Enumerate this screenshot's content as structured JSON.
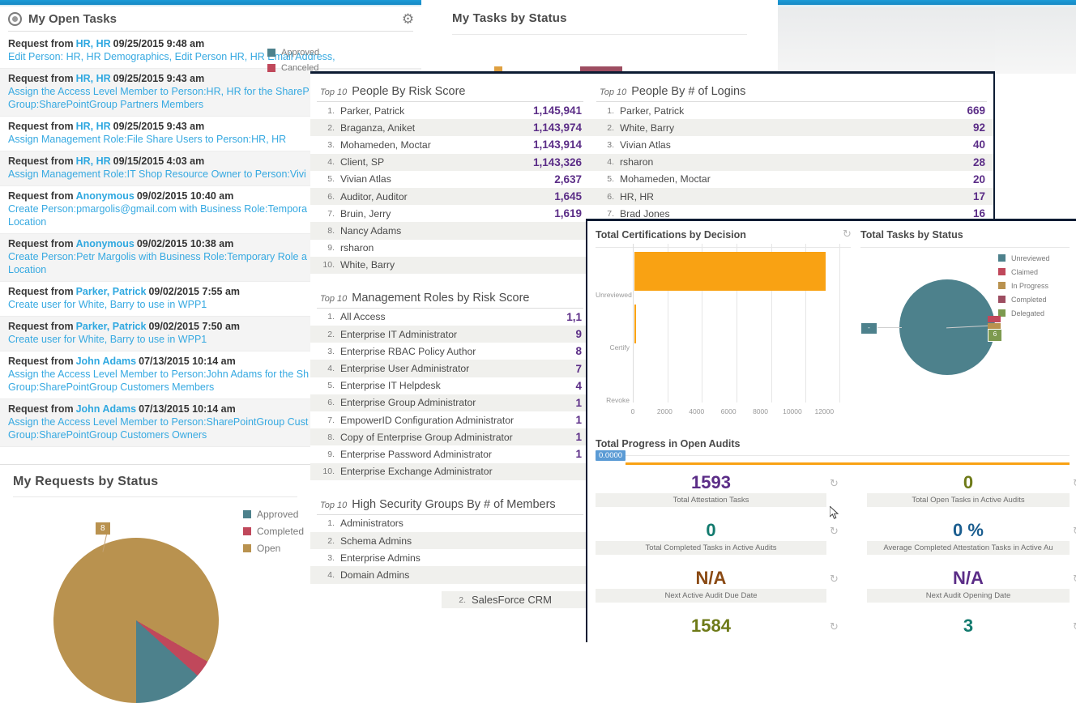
{
  "open_tasks": {
    "panel_title": "My Open Tasks",
    "radio_icon": "radio-button-icon",
    "gear_icon": "gear-icon",
    "items": [
      {
        "prefix": "Request from",
        "who": "HR, HR",
        "when": "09/25/2015 9:48 am",
        "desc": "Edit Person: HR, HR Demographics, Edit Person HR, HR Email Address,"
      },
      {
        "prefix": "Request from",
        "who": "HR, HR",
        "when": "09/25/2015 9:43 am",
        "desc": "Assign the Access Level Member to Person:HR, HR for the ShareP Group:SharePointGroup Partners Members"
      },
      {
        "prefix": "Request from",
        "who": "HR, HR",
        "when": "09/25/2015 9:43 am",
        "desc": "Assign Management Role:File Share Users to Person:HR, HR"
      },
      {
        "prefix": "Request from",
        "who": "HR, HR",
        "when": "09/15/2015 4:03 am",
        "desc": "Assign Management Role:IT Shop Resource Owner to Person:Vivi"
      },
      {
        "prefix": "Request from",
        "who": "Anonymous",
        "when": "09/02/2015 10:40 am",
        "desc": "Create Person:pmargolis@gmail.com with Business Role:Tempora Location:Temporary Location"
      },
      {
        "prefix": "Request from",
        "who": "Anonymous",
        "when": "09/02/2015 10:38 am",
        "desc": "Create Person:Petr Margolis with Business Role:Temporary Role a Location:Temporary Location"
      },
      {
        "prefix": "Request from",
        "who": "Parker, Patrick",
        "when": "09/02/2015 7:55 am",
        "desc": "Create user for White, Barry to use in WPP1"
      },
      {
        "prefix": "Request from",
        "who": "Parker, Patrick",
        "when": "09/02/2015 7:50 am",
        "desc": "Create user for White, Barry to use in WPP1"
      },
      {
        "prefix": "Request from",
        "who": "John Adams",
        "when": "07/13/2015 10:14 am",
        "desc": "Assign the Access Level Member to Person:John Adams for the Sh Group:SharePointGroup Customers Members"
      },
      {
        "prefix": "Request from",
        "who": "John Adams",
        "when": "07/13/2015 10:14 am",
        "desc": "Assign the Access Level Member to Person:SharePointGroup Cust SharePoint Group:SharePointGroup Customers Owners"
      }
    ]
  },
  "my_tasks_by_status": {
    "title": "My Tasks by Status",
    "refresh_icon": "refresh-icon",
    "legend": [
      {
        "label": "Approved",
        "color": "#4d818c"
      },
      {
        "label": "Canceled",
        "color": "#c0485b"
      }
    ]
  },
  "top_lists": [
    {
      "small": "Top 10",
      "title": "People By Risk Score",
      "rows": [
        {
          "idx": "1.",
          "name": "Parker, Patrick",
          "value": "1,145,941"
        },
        {
          "idx": "2.",
          "name": "Braganza, Aniket",
          "value": "1,143,974"
        },
        {
          "idx": "3.",
          "name": "Mohameden, Moctar",
          "value": "1,143,914"
        },
        {
          "idx": "4.",
          "name": "Client, SP",
          "value": "1,143,326"
        },
        {
          "idx": "5.",
          "name": "Vivian Atlas",
          "value": "2,637"
        },
        {
          "idx": "6.",
          "name": "Auditor, Auditor",
          "value": "1,645"
        },
        {
          "idx": "7.",
          "name": "Bruin, Jerry",
          "value": "1,619"
        },
        {
          "idx": "8.",
          "name": "Nancy Adams",
          "value": ""
        },
        {
          "idx": "9.",
          "name": "rsharon",
          "value": ""
        },
        {
          "idx": "10.",
          "name": "White, Barry",
          "value": ""
        }
      ]
    },
    {
      "small": "Top 10",
      "title": "Management Roles by Risk Score",
      "rows": [
        {
          "idx": "1.",
          "name": "All Access",
          "value": "1,1"
        },
        {
          "idx": "2.",
          "name": "Enterprise IT Administrator",
          "value": "9"
        },
        {
          "idx": "3.",
          "name": "Enterprise RBAC Policy Author",
          "value": "8"
        },
        {
          "idx": "4.",
          "name": "Enterprise User Administrator",
          "value": "7"
        },
        {
          "idx": "5.",
          "name": "Enterprise IT Helpdesk",
          "value": "4"
        },
        {
          "idx": "6.",
          "name": "Enterprise Group Administrator",
          "value": "1"
        },
        {
          "idx": "7.",
          "name": "EmpowerID Configuration Administrator",
          "value": "1"
        },
        {
          "idx": "8.",
          "name": "Copy of Enterprise Group Administrator",
          "value": "1"
        },
        {
          "idx": "9.",
          "name": "Enterprise Password Administrator",
          "value": "1"
        },
        {
          "idx": "10.",
          "name": "Enterprise Exchange Administrator",
          "value": ""
        }
      ]
    },
    {
      "small": "Top 10",
      "title": "High Security Groups By # of Members",
      "rows": [
        {
          "idx": "1.",
          "name": "Administrators",
          "value": ""
        },
        {
          "idx": "2.",
          "name": "Schema Admins",
          "value": ""
        },
        {
          "idx": "3.",
          "name": "Enterprise Admins",
          "value": ""
        },
        {
          "idx": "4.",
          "name": "Domain Admins",
          "value": ""
        }
      ]
    }
  ],
  "logins_list": {
    "small": "Top 10",
    "title": "People By # of Logins",
    "rows": [
      {
        "idx": "1.",
        "name": "Parker, Patrick",
        "value": "669"
      },
      {
        "idx": "2.",
        "name": "White, Barry",
        "value": "92"
      },
      {
        "idx": "3.",
        "name": "Vivian Atlas",
        "value": "40"
      },
      {
        "idx": "4.",
        "name": "rsharon",
        "value": "28"
      },
      {
        "idx": "5.",
        "name": "Mohameden, Moctar",
        "value": "20"
      },
      {
        "idx": "6.",
        "name": "HR, HR",
        "value": "17"
      },
      {
        "idx": "7.",
        "name": "Brad Jones",
        "value": "16"
      }
    ]
  },
  "partial_list_item": {
    "idx": "2.",
    "name": "SalesForce CRM"
  },
  "chart_data": [
    {
      "type": "bar",
      "title": "Total Certifications by Decision",
      "orientation": "horizontal",
      "categories": [
        "Unreviewed",
        "Certify",
        "Revoke"
      ],
      "values": [
        12000,
        90,
        0
      ],
      "xlabel": "",
      "ylabel": "",
      "xlim": [
        0,
        13000
      ],
      "xticks": [
        0,
        2000,
        4000,
        6000,
        8000,
        10000,
        12000
      ],
      "xticklabels": [
        "0",
        "2000",
        "4000",
        "6000",
        "8000",
        "10000",
        "12000"
      ],
      "grid": true,
      "legend": "none",
      "bar_color": "#f9a213"
    },
    {
      "type": "pie",
      "title": "Total Tasks by Status",
      "labels": [
        "Unreviewed",
        "Claimed",
        "In Progress",
        "Completed",
        "Delegated"
      ],
      "colors": [
        "#4d818c",
        "#c0485b",
        "#b9924f",
        "#9d4d61",
        "#7d9a4f"
      ],
      "values": [
        1584,
        6,
        3,
        2,
        6
      ],
      "data_labels": [
        "-",
        "",
        "",
        "",
        "6"
      ],
      "legend": "right"
    },
    {
      "type": "pie",
      "title": "My Requests by Status",
      "labels": [
        "Approved",
        "Completed",
        "Open"
      ],
      "colors": [
        "#4d818c",
        "#c0485b",
        "#b9924f"
      ],
      "values": [
        1,
        1,
        8
      ],
      "data_labels": [
        "",
        "",
        "8"
      ],
      "legend": "right"
    },
    {
      "type": "bar",
      "title": "Total Progress in Open Audits",
      "orientation": "horizontal",
      "categories": [
        ""
      ],
      "values": [
        0.0
      ],
      "data_labels": [
        "0.0000"
      ],
      "bar_color": "#f9a213",
      "legend": "none"
    }
  ],
  "right_dashboard": {
    "cert_chart_title": "Total Certifications by Decision",
    "tasks_pie_title": "Total Tasks by Status",
    "progress_title": "Total Progress in Open Audits",
    "progress_badge": "0.0000",
    "refresh_icon": "refresh-icon",
    "tiles": [
      {
        "value": "1593",
        "caption": "Total Attestation Tasks",
        "color": "#5b2d87"
      },
      {
        "value": "0",
        "caption": "Total Open Tasks in Active Audits",
        "color": "#6e7a18"
      },
      {
        "value": "0",
        "caption": "Total Completed Tasks in Active Audits",
        "color": "#127a6e"
      },
      {
        "value": "0 %",
        "caption": "Average Completed Attestation Tasks in Active Au",
        "color": "#1a5d8f"
      },
      {
        "value": "N/A",
        "caption": "Next Active Audit Due Date",
        "color": "#8a4a14"
      },
      {
        "value": "N/A",
        "caption": "Next Audit Opening Date",
        "color": "#5b2d87"
      },
      {
        "value": "1584",
        "caption": "",
        "color": "#6e7a18"
      },
      {
        "value": "3",
        "caption": "",
        "color": "#127a6e"
      }
    ]
  },
  "my_requests": {
    "title": "My Requests by Status",
    "legend": [
      {
        "label": "Approved",
        "color": "#4d818c"
      },
      {
        "label": "Completed",
        "color": "#c0485b"
      },
      {
        "label": "Open",
        "color": "#b9924f"
      }
    ],
    "badge": "8"
  },
  "cursor": {
    "icon": "mouse-pointer-icon"
  }
}
